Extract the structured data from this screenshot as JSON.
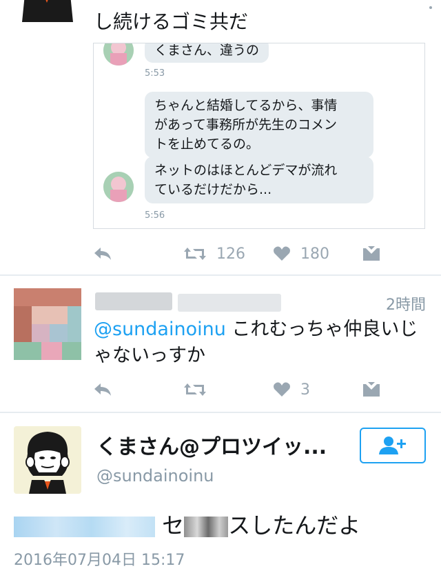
{
  "top_tweet": {
    "text": "し続けるゴミ共だ"
  },
  "dm": {
    "messages": [
      {
        "text": "くまさん、違うの"
      },
      {
        "text": "5:53"
      },
      {
        "text": "ちゃんと結婚してるから、事情\nがあって事務所が先生のコメン\nトを止めてるの。"
      },
      {
        "text": "ネットのはほとんどデマが流れ\nているだけだから..."
      },
      {
        "text": "5:56"
      }
    ]
  },
  "top_actions": {
    "retweet_count": "126",
    "like_count": "180"
  },
  "reply_tweet": {
    "time": "2時間",
    "mention": "@sundainoinu",
    "text_line1": " これむっちゃ仲良いじ",
    "text_line2": "ゃないっすか"
  },
  "reply_actions": {
    "like_count": "3"
  },
  "main_tweet": {
    "display_name": "くまさん@プロツイッ...",
    "handle": "@sundainoinu",
    "text_part1": "セ",
    "text_part2": "スしたんだよ",
    "date": "2016年07月04日 15:17"
  },
  "colors": {
    "accent": "#1da1f2",
    "muted": "#8899a6",
    "icon": "#9aa7b2"
  },
  "icons": [
    "reply-icon",
    "retweet-icon",
    "heart-icon",
    "dm-envelope-icon",
    "follow-add-user-icon"
  ]
}
